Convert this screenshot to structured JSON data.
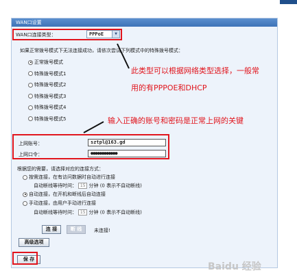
{
  "panel": {
    "title": "WAN口设置"
  },
  "wan_type": {
    "label": "WAN口连接类型：",
    "selected": "PPPoE"
  },
  "dial_hint": "如果正常拨号模式下无法连接成功，请依次尝试下列模式中的特殊拨号模式：",
  "dial_modes": [
    {
      "label": "正常拨号模式",
      "checked": true
    },
    {
      "label": "特殊拨号模式1",
      "checked": false
    },
    {
      "label": "特殊拨号模式2",
      "checked": false
    },
    {
      "label": "特殊拨号模式3",
      "checked": false
    },
    {
      "label": "特殊拨号模式4",
      "checked": false
    },
    {
      "label": "特殊拨号模式5",
      "checked": false
    }
  ],
  "account": {
    "username_label": "上网账号：",
    "username_value": "sztpl@163.gd",
    "password_label": "上网口令：",
    "password_value": "●●●●●●●●●●●●"
  },
  "connect": {
    "intro": "根据您的需要，请选择对应的连接方式：",
    "on_demand_label": "按需连接，在有访问数据时自动进行连接",
    "on_demand_idle_prefix": "自动断线等待时间：",
    "on_demand_idle_value": "15",
    "on_demand_idle_suffix": "分钟 (0 表示不自动断线)",
    "auto_label": "自动连接，在开机和断线后自动连接",
    "manual_label": "手动连接，由用户手动进行连接",
    "manual_idle_prefix": "自动断线等待时间：",
    "manual_idle_value": "15",
    "manual_idle_suffix": "分钟 (0 表示不自动断线)",
    "connect_button": "连 接",
    "disconnect_button": "断 线",
    "status": "未连接!"
  },
  "advanced_button": "高级选项",
  "save_button": "保 存",
  "annotations": {
    "note1_line1": "此类型可以根据网络类型选择，一般常",
    "note1_line2": "用的有PPPOE和DHCP",
    "note2": "输入正确的账号和密码是正常上网的关键"
  },
  "watermark": "Baidu 经验",
  "colors": {
    "annotation_red": "#e1141c",
    "title_blue": "#3e73b8"
  }
}
